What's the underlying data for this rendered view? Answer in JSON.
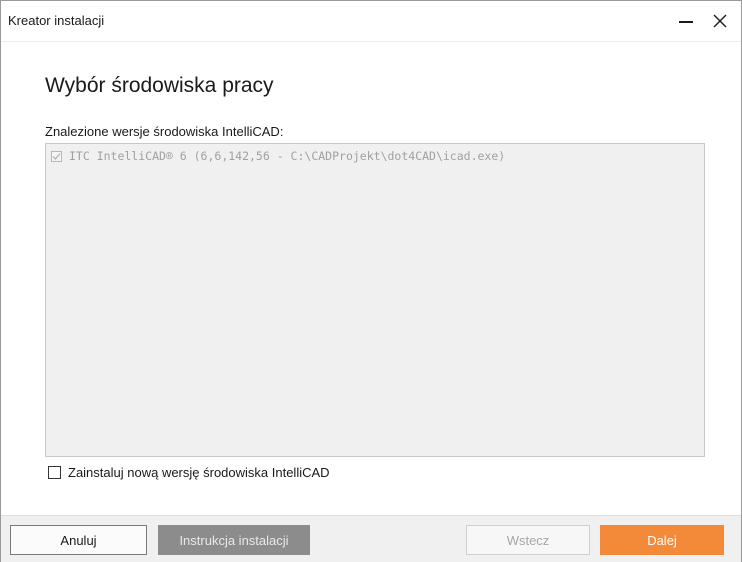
{
  "window": {
    "title": "Kreator instalacji"
  },
  "page": {
    "heading": "Wybór środowiska pracy",
    "list_label": "Znalezione wersje środowiska IntelliCAD:",
    "environments": [
      {
        "label": "ITC IntelliCAD® 6 (6,6,142,56 - C:\\CADProjekt\\dot4CAD\\icad.exe)",
        "checked": true,
        "enabled": false
      }
    ],
    "install_new": {
      "label": "Zainstaluj nową wersję środowiska IntelliCAD",
      "checked": false
    }
  },
  "footer": {
    "cancel_label": "Anuluj",
    "guide_label": "Instrukcja instalacji",
    "back_label": "Wstecz",
    "next_label": "Dalej"
  },
  "colors": {
    "accent": "#f28a3a",
    "secondary_button": "#8c8c8c",
    "disabled_text": "#a0a0a0",
    "footer_bg": "#f0f0f0"
  },
  "icons": [
    "minimize-icon",
    "close-icon",
    "checkmark-icon"
  ]
}
